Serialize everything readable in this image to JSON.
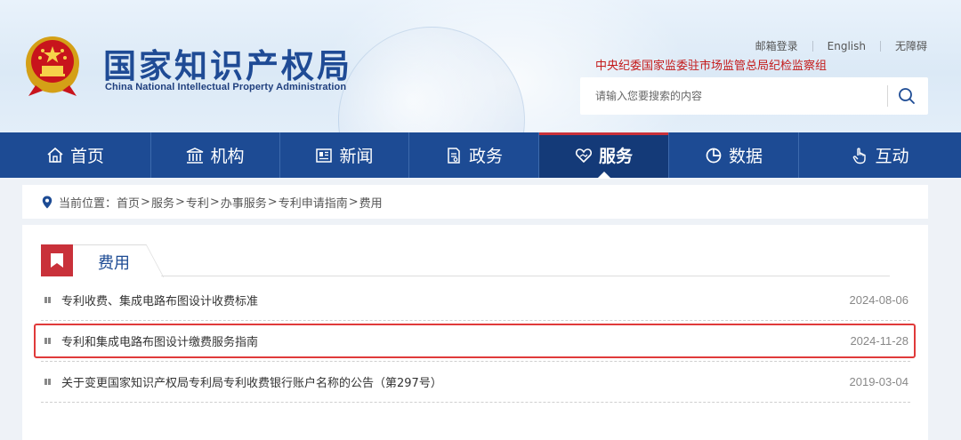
{
  "header": {
    "title": "国家知识产权局",
    "subtitle": "China National Intellectual Property Administration",
    "links": [
      "邮箱登录",
      "English",
      "无障碍"
    ],
    "supervision": "中央纪委国家监委驻市场监管总局纪检监察组",
    "search_placeholder": "请输入您要搜索的内容"
  },
  "nav": {
    "items": [
      {
        "label": "首页",
        "icon": "home-icon"
      },
      {
        "label": "机构",
        "icon": "institution-icon"
      },
      {
        "label": "新闻",
        "icon": "news-icon"
      },
      {
        "label": "政务",
        "icon": "document-icon"
      },
      {
        "label": "服务",
        "icon": "heart-hand-icon",
        "active": true
      },
      {
        "label": "数据",
        "icon": "pie-chart-icon"
      },
      {
        "label": "互动",
        "icon": "hand-pointer-icon"
      }
    ]
  },
  "breadcrumb": {
    "prefix": "当前位置：",
    "items": [
      "首页",
      "服务",
      "专利",
      "办事服务",
      "专利申请指南",
      "费用"
    ],
    "separator": ">"
  },
  "section": {
    "title": "费用",
    "items": [
      {
        "title": "专利收费、集成电路布图设计收费标准",
        "date": "2024-08-06"
      },
      {
        "title": "专利和集成电路布图设计缴费服务指南",
        "date": "2024-11-28",
        "highlighted": true
      },
      {
        "title": "关于变更国家知识产权局专利局专利收费银行账户名称的公告（第297号）",
        "date": "2019-03-04"
      }
    ]
  },
  "colors": {
    "nav_bg": "#1d4b94",
    "nav_active": "#143a78",
    "accent_red": "#c9313a",
    "title_blue": "#1f4b95",
    "highlight_box": "#e03a3a"
  }
}
